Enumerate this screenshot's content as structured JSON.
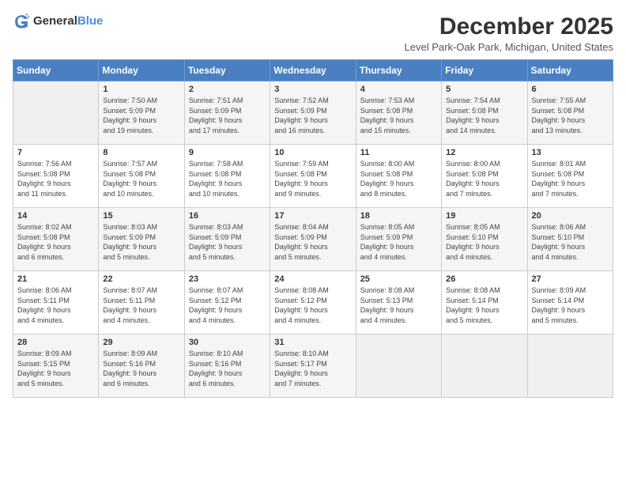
{
  "header": {
    "logo_general": "General",
    "logo_blue": "Blue",
    "month": "December 2025",
    "location": "Level Park-Oak Park, Michigan, United States"
  },
  "days_of_week": [
    "Sunday",
    "Monday",
    "Tuesday",
    "Wednesday",
    "Thursday",
    "Friday",
    "Saturday"
  ],
  "weeks": [
    [
      {
        "day": "",
        "content": ""
      },
      {
        "day": "1",
        "content": "Sunrise: 7:50 AM\nSunset: 5:09 PM\nDaylight: 9 hours\nand 19 minutes."
      },
      {
        "day": "2",
        "content": "Sunrise: 7:51 AM\nSunset: 5:09 PM\nDaylight: 9 hours\nand 17 minutes."
      },
      {
        "day": "3",
        "content": "Sunrise: 7:52 AM\nSunset: 5:09 PM\nDaylight: 9 hours\nand 16 minutes."
      },
      {
        "day": "4",
        "content": "Sunrise: 7:53 AM\nSunset: 5:08 PM\nDaylight: 9 hours\nand 15 minutes."
      },
      {
        "day": "5",
        "content": "Sunrise: 7:54 AM\nSunset: 5:08 PM\nDaylight: 9 hours\nand 14 minutes."
      },
      {
        "day": "6",
        "content": "Sunrise: 7:55 AM\nSunset: 5:08 PM\nDaylight: 9 hours\nand 13 minutes."
      }
    ],
    [
      {
        "day": "7",
        "content": "Sunrise: 7:56 AM\nSunset: 5:08 PM\nDaylight: 9 hours\nand 11 minutes."
      },
      {
        "day": "8",
        "content": "Sunrise: 7:57 AM\nSunset: 5:08 PM\nDaylight: 9 hours\nand 10 minutes."
      },
      {
        "day": "9",
        "content": "Sunrise: 7:58 AM\nSunset: 5:08 PM\nDaylight: 9 hours\nand 10 minutes."
      },
      {
        "day": "10",
        "content": "Sunrise: 7:59 AM\nSunset: 5:08 PM\nDaylight: 9 hours\nand 9 minutes."
      },
      {
        "day": "11",
        "content": "Sunrise: 8:00 AM\nSunset: 5:08 PM\nDaylight: 9 hours\nand 8 minutes."
      },
      {
        "day": "12",
        "content": "Sunrise: 8:00 AM\nSunset: 5:08 PM\nDaylight: 9 hours\nand 7 minutes."
      },
      {
        "day": "13",
        "content": "Sunrise: 8:01 AM\nSunset: 5:08 PM\nDaylight: 9 hours\nand 7 minutes."
      }
    ],
    [
      {
        "day": "14",
        "content": "Sunrise: 8:02 AM\nSunset: 5:08 PM\nDaylight: 9 hours\nand 6 minutes."
      },
      {
        "day": "15",
        "content": "Sunrise: 8:03 AM\nSunset: 5:09 PM\nDaylight: 9 hours\nand 5 minutes."
      },
      {
        "day": "16",
        "content": "Sunrise: 8:03 AM\nSunset: 5:09 PM\nDaylight: 9 hours\nand 5 minutes."
      },
      {
        "day": "17",
        "content": "Sunrise: 8:04 AM\nSunset: 5:09 PM\nDaylight: 9 hours\nand 5 minutes."
      },
      {
        "day": "18",
        "content": "Sunrise: 8:05 AM\nSunset: 5:09 PM\nDaylight: 9 hours\nand 4 minutes."
      },
      {
        "day": "19",
        "content": "Sunrise: 8:05 AM\nSunset: 5:10 PM\nDaylight: 9 hours\nand 4 minutes."
      },
      {
        "day": "20",
        "content": "Sunrise: 8:06 AM\nSunset: 5:10 PM\nDaylight: 9 hours\nand 4 minutes."
      }
    ],
    [
      {
        "day": "21",
        "content": "Sunrise: 8:06 AM\nSunset: 5:11 PM\nDaylight: 9 hours\nand 4 minutes."
      },
      {
        "day": "22",
        "content": "Sunrise: 8:07 AM\nSunset: 5:11 PM\nDaylight: 9 hours\nand 4 minutes."
      },
      {
        "day": "23",
        "content": "Sunrise: 8:07 AM\nSunset: 5:12 PM\nDaylight: 9 hours\nand 4 minutes."
      },
      {
        "day": "24",
        "content": "Sunrise: 8:08 AM\nSunset: 5:12 PM\nDaylight: 9 hours\nand 4 minutes."
      },
      {
        "day": "25",
        "content": "Sunrise: 8:08 AM\nSunset: 5:13 PM\nDaylight: 9 hours\nand 4 minutes."
      },
      {
        "day": "26",
        "content": "Sunrise: 8:08 AM\nSunset: 5:14 PM\nDaylight: 9 hours\nand 5 minutes."
      },
      {
        "day": "27",
        "content": "Sunrise: 8:09 AM\nSunset: 5:14 PM\nDaylight: 9 hours\nand 5 minutes."
      }
    ],
    [
      {
        "day": "28",
        "content": "Sunrise: 8:09 AM\nSunset: 5:15 PM\nDaylight: 9 hours\nand 5 minutes."
      },
      {
        "day": "29",
        "content": "Sunrise: 8:09 AM\nSunset: 5:16 PM\nDaylight: 9 hours\nand 6 minutes."
      },
      {
        "day": "30",
        "content": "Sunrise: 8:10 AM\nSunset: 5:16 PM\nDaylight: 9 hours\nand 6 minutes."
      },
      {
        "day": "31",
        "content": "Sunrise: 8:10 AM\nSunset: 5:17 PM\nDaylight: 9 hours\nand 7 minutes."
      },
      {
        "day": "",
        "content": ""
      },
      {
        "day": "",
        "content": ""
      },
      {
        "day": "",
        "content": ""
      }
    ]
  ]
}
